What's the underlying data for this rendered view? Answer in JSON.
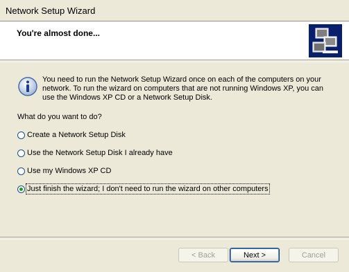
{
  "window": {
    "title": "Network Setup Wizard"
  },
  "header": {
    "title": "You're almost done..."
  },
  "info": {
    "text": "You need to run the Network Setup Wizard once on each of the computers on your network. To run the wizard on computers that are not running Windows XP, you can use the Windows XP CD or a Network Setup Disk."
  },
  "question": "What do you want to do?",
  "options": [
    {
      "label": "Create a Network Setup Disk",
      "checked": false
    },
    {
      "label": "Use the Network Setup Disk I already have",
      "checked": false
    },
    {
      "label": "Use my Windows XP CD",
      "checked": false
    },
    {
      "label": "Just finish the wizard; I don't need to run the wizard on other computers",
      "checked": true
    }
  ],
  "buttons": {
    "back": "< Back",
    "next": "Next >",
    "cancel": "Cancel"
  }
}
